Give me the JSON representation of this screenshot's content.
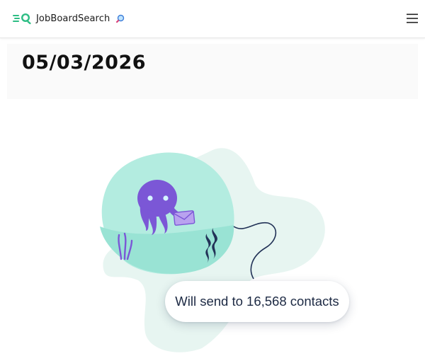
{
  "header": {
    "brand_name": "JobBoardSearch",
    "logo_icon": "magnifier-speed-logo",
    "brand_trailing_icon": "magnifying-glass-icon",
    "menu_icon": "hamburger-menu-icon"
  },
  "campaign": {
    "date": "05/03/2026"
  },
  "send_summary": {
    "text": "Will send to 16,568 contacts"
  },
  "colors": {
    "brand_green": "#2dbd84",
    "mascot_purple": "#7b57d6",
    "blob_mint": "#b3ece0",
    "pale_blob": "#e7f5f1",
    "text_dark": "#1d2a44"
  }
}
